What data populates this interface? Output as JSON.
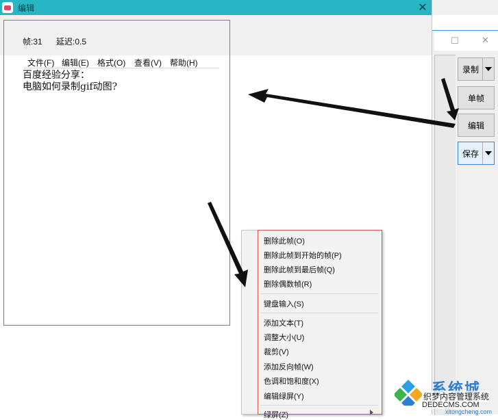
{
  "window": {
    "title": "编辑",
    "close_glyph": "✕"
  },
  "info": {
    "frame_label": "帧:31",
    "delay_label": "延迟:0.5"
  },
  "menubar": {
    "items": [
      "文件(F)",
      "编辑(E)",
      "格式(O)",
      "查看(V)",
      "帮助(H)"
    ]
  },
  "content": {
    "line1": "百度经验分享：",
    "line2": "电脑如何录制gif动图?"
  },
  "side_buttons": {
    "record": "录制",
    "single_frame": "单帧",
    "edit": "编辑",
    "save": "保存"
  },
  "background_window": {
    "minimize_glyph": "☐",
    "close_glyph": "✕"
  },
  "context_menu": {
    "group1": [
      "删除此帧(O)",
      "删除此帧到开始的帧(P)",
      "删除此帧到最后帧(Q)",
      "删除偶数帧(R)"
    ],
    "group2": [
      "键盘输入(S)"
    ],
    "group3": [
      "添加文本(T)",
      "调整大小(U)",
      "裁剪(V)",
      "添加反向帧(W)",
      "色调和饱和度(X)",
      "编辑绿屏(Y)"
    ],
    "group4": [
      "绿屏(Z)"
    ]
  },
  "watermark": {
    "title": "系统城",
    "subtitle": "织梦内容管理系统",
    "url": "DEDECMS.COM",
    "url2": "xitongcheng.com"
  },
  "colors": {
    "titlebar": "#26b6c4",
    "highlight_frame": "#d9534f",
    "watermark_blue": "#2f7fd0"
  }
}
